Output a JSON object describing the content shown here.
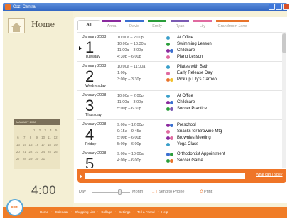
{
  "window": {
    "title": "Cozi Central"
  },
  "sidebar": {
    "home_title": "Home",
    "mini_calendar": {
      "header": "JANUARY 2008",
      "rows": [
        [
          "",
          "",
          "",
          "1",
          "2",
          "3",
          "4",
          "5"
        ],
        [
          "6",
          "7",
          "8",
          "9",
          "10",
          "11",
          "12"
        ],
        [
          "13",
          "14",
          "15",
          "16",
          "17",
          "18",
          "19"
        ],
        [
          "20",
          "21",
          "22",
          "23",
          "24",
          "25",
          "26"
        ],
        [
          "27",
          "28",
          "29",
          "30",
          "31"
        ]
      ]
    },
    "clock": "4:00"
  },
  "tabs": [
    {
      "label": "All",
      "selected": true,
      "color": ""
    },
    {
      "label": "Anna",
      "selected": false,
      "color": "#8a2a9e"
    },
    {
      "label": "David",
      "selected": false,
      "color": "#3a6fd0"
    },
    {
      "label": "Emily",
      "selected": false,
      "color": "#2a9d3a"
    },
    {
      "label": "Ryan",
      "selected": false,
      "color": "#7a5ab2"
    },
    {
      "label": "Lily",
      "selected": false,
      "color": "#e06aa0"
    },
    {
      "label": "Grandmom Jane",
      "selected": false,
      "color": "#e8732b"
    }
  ],
  "days": [
    {
      "month": "January 2008",
      "number": "1",
      "weekday": "Tuesday",
      "today": true,
      "events": [
        {
          "time": "10:00a – 2:00p",
          "title": "At Office",
          "dots": [
            "#3a9fc9"
          ]
        },
        {
          "time": "10:00a – 10:30a",
          "title": "Swimming Lesson",
          "dots": [
            "#2a9d3a"
          ]
        },
        {
          "time": "11:00a – 3:00p",
          "title": "Childcare",
          "dots": [
            "#8a2a9e",
            "#3a6fd0"
          ]
        },
        {
          "time": "4:30p – 6:00p",
          "title": "Piano Lesson",
          "dots": [
            "#e06aa0"
          ]
        }
      ]
    },
    {
      "month": "January 2008",
      "number": "2",
      "weekday": "Wednesday",
      "today": false,
      "events": [
        {
          "time": "10:00a – 11:00a",
          "title": "Pilates with Beth",
          "dots": [
            "#3a9fc9"
          ]
        },
        {
          "time": "1:00p",
          "title": "Early Release Day",
          "dots": [
            "#e06aa0"
          ]
        },
        {
          "time": "3:00p – 3:30p",
          "title": "Pick up Lily's Carpool",
          "dots": [
            "#e8732b",
            "#f2c12e"
          ]
        }
      ]
    },
    {
      "month": "January 2008",
      "number": "3",
      "weekday": "Thursday",
      "today": false,
      "events": [
        {
          "time": "10:00a – 2:00p",
          "title": "At Office",
          "dots": [
            "#3a9fc9"
          ]
        },
        {
          "time": "11:00a – 3:00p",
          "title": "Childcare",
          "dots": [
            "#8a2a9e",
            "#3a6fd0"
          ]
        },
        {
          "time": "5:00p – 6:30p",
          "title": "Soccer Practice",
          "dots": [
            "#2a9d3a",
            "#7a5ab2"
          ]
        }
      ]
    },
    {
      "month": "January 2008",
      "number": "4",
      "weekday": "Friday",
      "today": false,
      "events": [
        {
          "time": "9:00a – 12:00p",
          "title": "Preschool",
          "dots": [
            "#8a2a9e",
            "#3a6fd0"
          ]
        },
        {
          "time": "9:15a – 9:45a",
          "title": "Snacks for Browine Mtg",
          "dots": [
            "#e06aa0"
          ]
        },
        {
          "time": "5:00p – 6:00p",
          "title": "Brownies Meeting",
          "dots": [
            "#8a2a9e",
            "#e06aa0"
          ]
        },
        {
          "time": "5:00p – 6:00p",
          "title": "Yoga Class",
          "dots": [
            "#3a9fc9"
          ]
        }
      ]
    },
    {
      "month": "January 2008",
      "number": "5",
      "weekday": "Saturday",
      "today": false,
      "events": [
        {
          "time": "9:00a – 10:00a",
          "title": "Orthodontist Appointment",
          "dots": [
            "#3a6fd0",
            "#2a9d3a"
          ]
        },
        {
          "time": "4:00p – 6:00p",
          "title": "Soccer Game",
          "dots": [
            "#2a9d3a",
            "#e8732b"
          ]
        }
      ]
    }
  ],
  "input": {
    "placeholder": "",
    "help_link": "What can I type?"
  },
  "controls": {
    "day_label": "Day",
    "month_label": "Month",
    "send_label": "Send to Phone",
    "print_label": "Print",
    "zoom_fraction": 0.74
  },
  "footer": {
    "logo_text": "cozi",
    "nav": [
      "Home",
      "Calendar",
      "Shopping List",
      "Collage",
      "Settings",
      "Tell a Friend",
      "Help"
    ]
  }
}
